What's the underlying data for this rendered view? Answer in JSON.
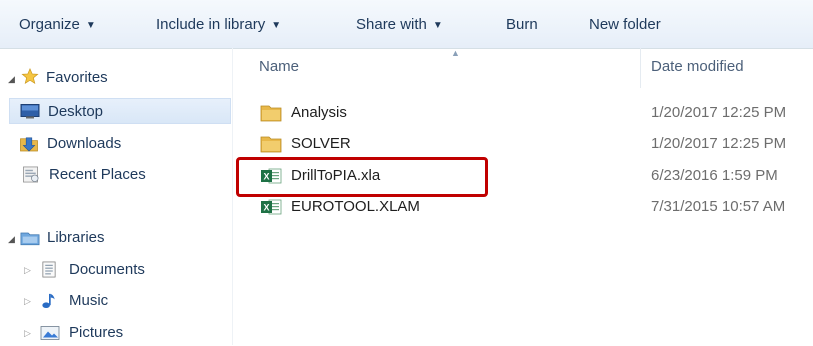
{
  "toolbar": {
    "organize": "Organize",
    "include_in_library": "Include in library",
    "share_with": "Share with",
    "burn": "Burn",
    "new_folder": "New folder",
    "caret": "▼"
  },
  "nav": {
    "favorites": {
      "label": "Favorites",
      "items": [
        {
          "label": "Desktop",
          "selected": true
        },
        {
          "label": "Downloads"
        },
        {
          "label": "Recent Places"
        }
      ]
    },
    "libraries": {
      "label": "Libraries",
      "items": [
        {
          "label": "Documents"
        },
        {
          "label": "Music"
        },
        {
          "label": "Pictures"
        }
      ]
    }
  },
  "columns": {
    "name": "Name",
    "date_modified": "Date modified"
  },
  "files": [
    {
      "name": "Analysis",
      "date": "1/20/2017 12:25 PM",
      "type": "folder"
    },
    {
      "name": "SOLVER",
      "date": "1/20/2017 12:25 PM",
      "type": "folder"
    },
    {
      "name": "DrillToPIA.xla",
      "date": "6/23/2016 1:59 PM",
      "type": "excel-addin"
    },
    {
      "name": "EUROTOOL.XLAM",
      "date": "7/31/2015 10:57 AM",
      "type": "excel-addin"
    }
  ],
  "colors": {
    "highlight": "#c00000",
    "toolbar_text": "#1e395b",
    "folder": "#e8b84a",
    "excel": "#1e7145"
  }
}
